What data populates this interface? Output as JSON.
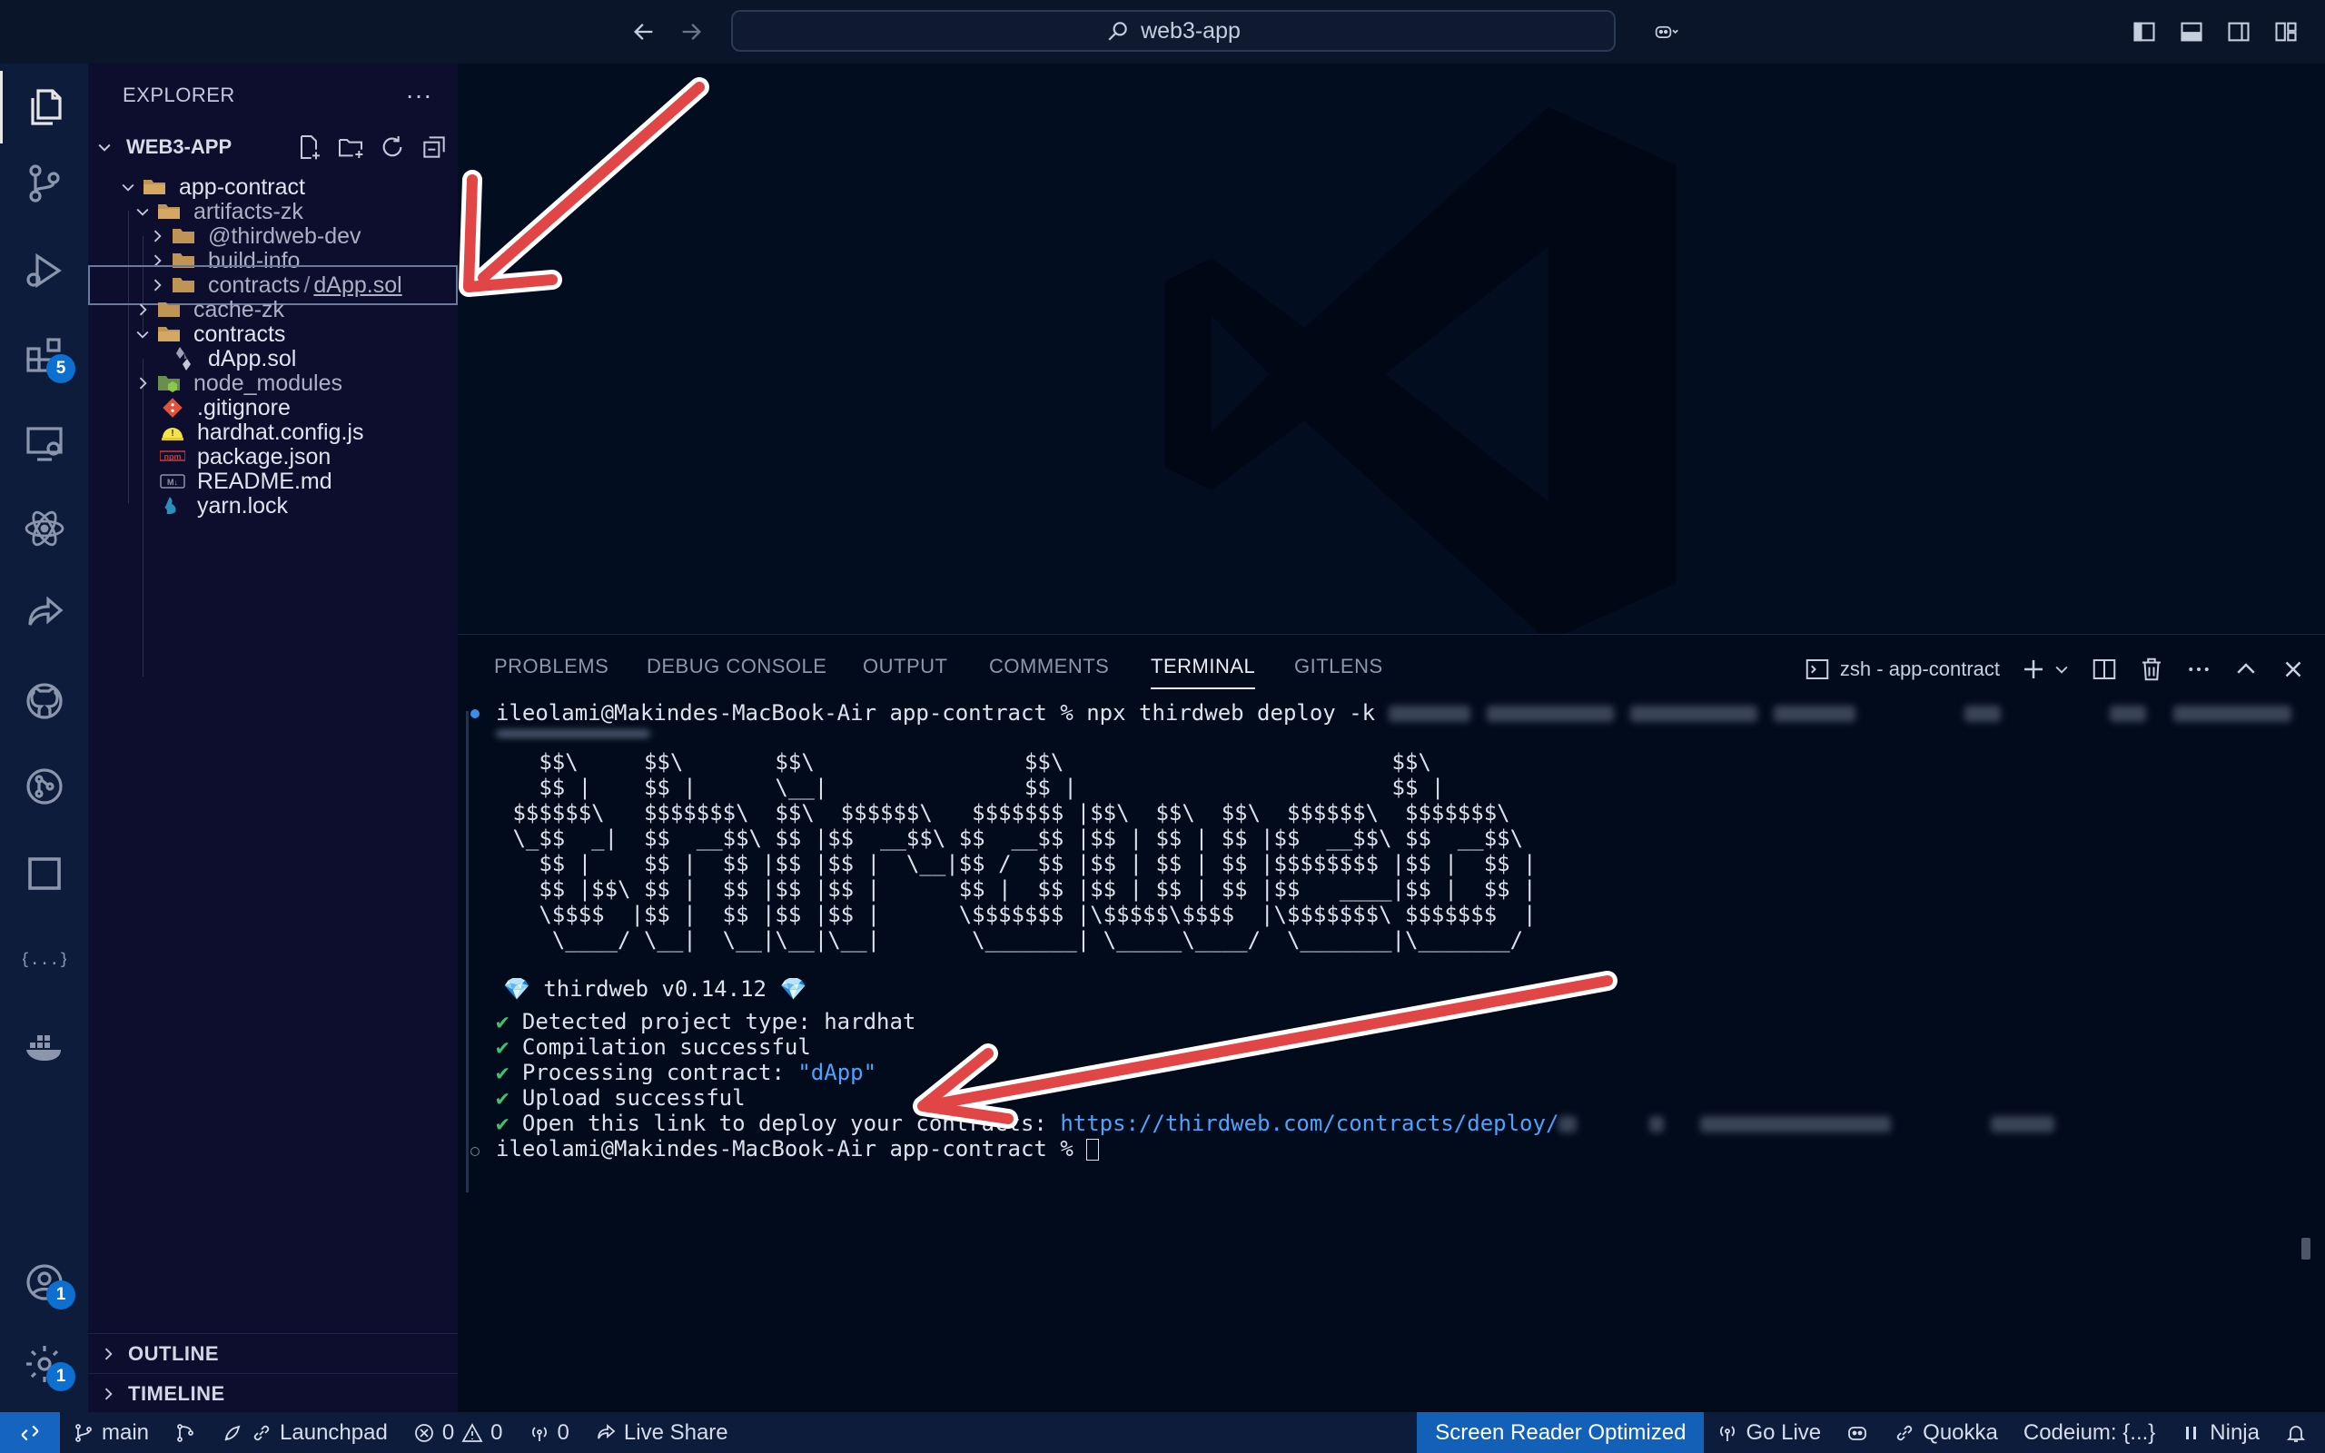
{
  "window": {
    "search_text": "web3-app"
  },
  "activity_bar": {
    "extensions_badge": "5",
    "accounts_badge": "1",
    "settings_badge": "1"
  },
  "sidebar": {
    "title": "EXPLORER",
    "more": "···",
    "workspace": "WEB3-APP",
    "tree": [
      {
        "name": "app-contract"
      },
      {
        "name": "artifacts-zk"
      },
      {
        "name": "@thirdweb-dev"
      },
      {
        "name": "build-info"
      },
      {
        "name_a": "contracts",
        "sep": "/",
        "name_b": "dApp.sol"
      },
      {
        "name": "cache-zk"
      },
      {
        "name": "contracts"
      },
      {
        "name": "dApp.sol"
      },
      {
        "name": "node_modules"
      },
      {
        "name": ".gitignore"
      },
      {
        "name": "hardhat.config.js"
      },
      {
        "name": "package.json"
      },
      {
        "name": "README.md"
      },
      {
        "name": "yarn.lock"
      }
    ],
    "outline": "OUTLINE",
    "timeline": "TIMELINE"
  },
  "panel": {
    "tabs": [
      "PROBLEMS",
      "DEBUG CONSOLE",
      "OUTPUT",
      "COMMENTS",
      "TERMINAL",
      "GITLENS"
    ],
    "active_tab": "TERMINAL",
    "terminal_name": "zsh - app-contract"
  },
  "terminal": {
    "prompt_cmd": "ileolami@Makindes-MacBook-Air app-contract % npx thirdweb deploy -k ",
    "banner": [
      "   $$\\     $$\\       $$\\                $$\\                         $$\\",
      "   $$ |    $$ |      \\__|               $$ |                        $$ |",
      " $$$$$$\\   $$$$$$$\\  $$\\  $$$$$$\\   $$$$$$$ |$$\\  $$\\  $$\\  $$$$$$\\  $$$$$$$\\",
      " \\_$$  _|  $$  __$$\\ $$ |$$  __$$\\ $$  __$$ |$$ | $$ | $$ |$$  __$$\\ $$  __$$\\",
      "   $$ |    $$ |  $$ |$$ |$$ |  \\__|$$ /  $$ |$$ | $$ | $$ |$$$$$$$$ |$$ |  $$ |",
      "   $$ |$$\\ $$ |  $$ |$$ |$$ |      $$ |  $$ |$$ | $$ | $$ |$$   ____|$$ |  $$ |",
      "   \\$$$$  |$$ |  $$ |$$ |$$ |      \\$$$$$$$ |\\$$$$$\\$$$$  |\\$$$$$$$\\ $$$$$$$  |",
      "    \\____/ \\__|  \\__|\\__|\\__|       \\_______| \\_____\\____/  \\_______|\\_______/"
    ],
    "version_line": " thirdweb v0.14.12 ",
    "checks": [
      {
        "mark": "✔",
        "text": " Detected project type: hardhat"
      },
      {
        "mark": "✔",
        "text": " Compilation successful"
      },
      {
        "mark": "✔",
        "text": " Processing contract: ",
        "highlight": "\"dApp\""
      },
      {
        "mark": "✔",
        "text": " Upload successful"
      },
      {
        "mark": "✔",
        "text": " Open this link to deploy your contracts: ",
        "link": "https://thirdweb.com/contracts/deploy/"
      }
    ],
    "prompt_end": "ileolami@Makindes-MacBook-Air app-contract % "
  },
  "statusbar": {
    "branch": "main",
    "launchpad": "Launchpad",
    "errors": "0",
    "warnings": "0",
    "ports": "0",
    "live_share": "Live Share",
    "screen_reader": "Screen Reader Optimized",
    "go_live": "Go Live",
    "quokka": "Quokka",
    "codeium": "Codeium: {...}",
    "ninja": "Ninja"
  },
  "colors": {
    "accent": "#1360b8",
    "arrow": "#e14545",
    "terminal_ok": "#3ec06c",
    "terminal_link": "#4ea3ff"
  }
}
